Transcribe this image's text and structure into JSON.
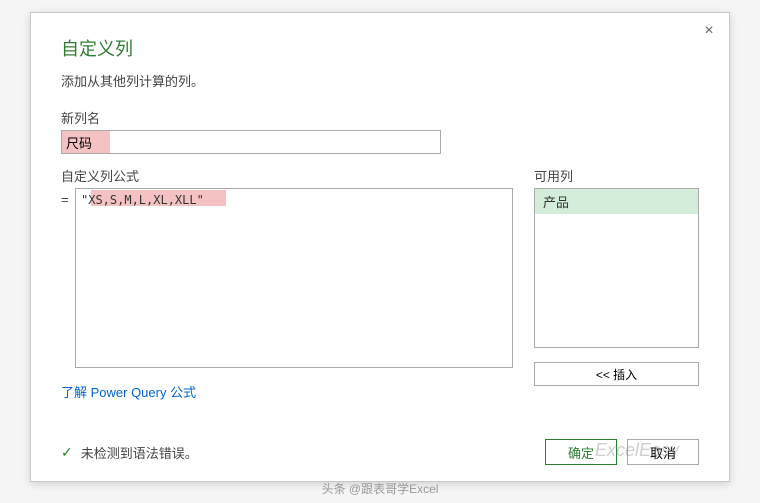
{
  "dialog": {
    "title": "自定义列",
    "subtitle": "添加从其他列计算的列。",
    "close_label": "×"
  },
  "newcol": {
    "label": "新列名",
    "value": "尺码"
  },
  "formula": {
    "label": "自定义列公式",
    "prefix": "=",
    "value": "\"XS,S,M,L,XL,XLL\""
  },
  "available": {
    "label": "可用列",
    "items": [
      "产品"
    ],
    "insert_btn": "<< 插入"
  },
  "link": {
    "text": "了解 Power Query 公式"
  },
  "status": {
    "ok_text": "未检测到语法错误。"
  },
  "buttons": {
    "ok": "确定",
    "cancel": "取消"
  },
  "watermark": {
    "bottom": "头条 @跟表哥学Excel",
    "right": "ExcelEasy"
  }
}
